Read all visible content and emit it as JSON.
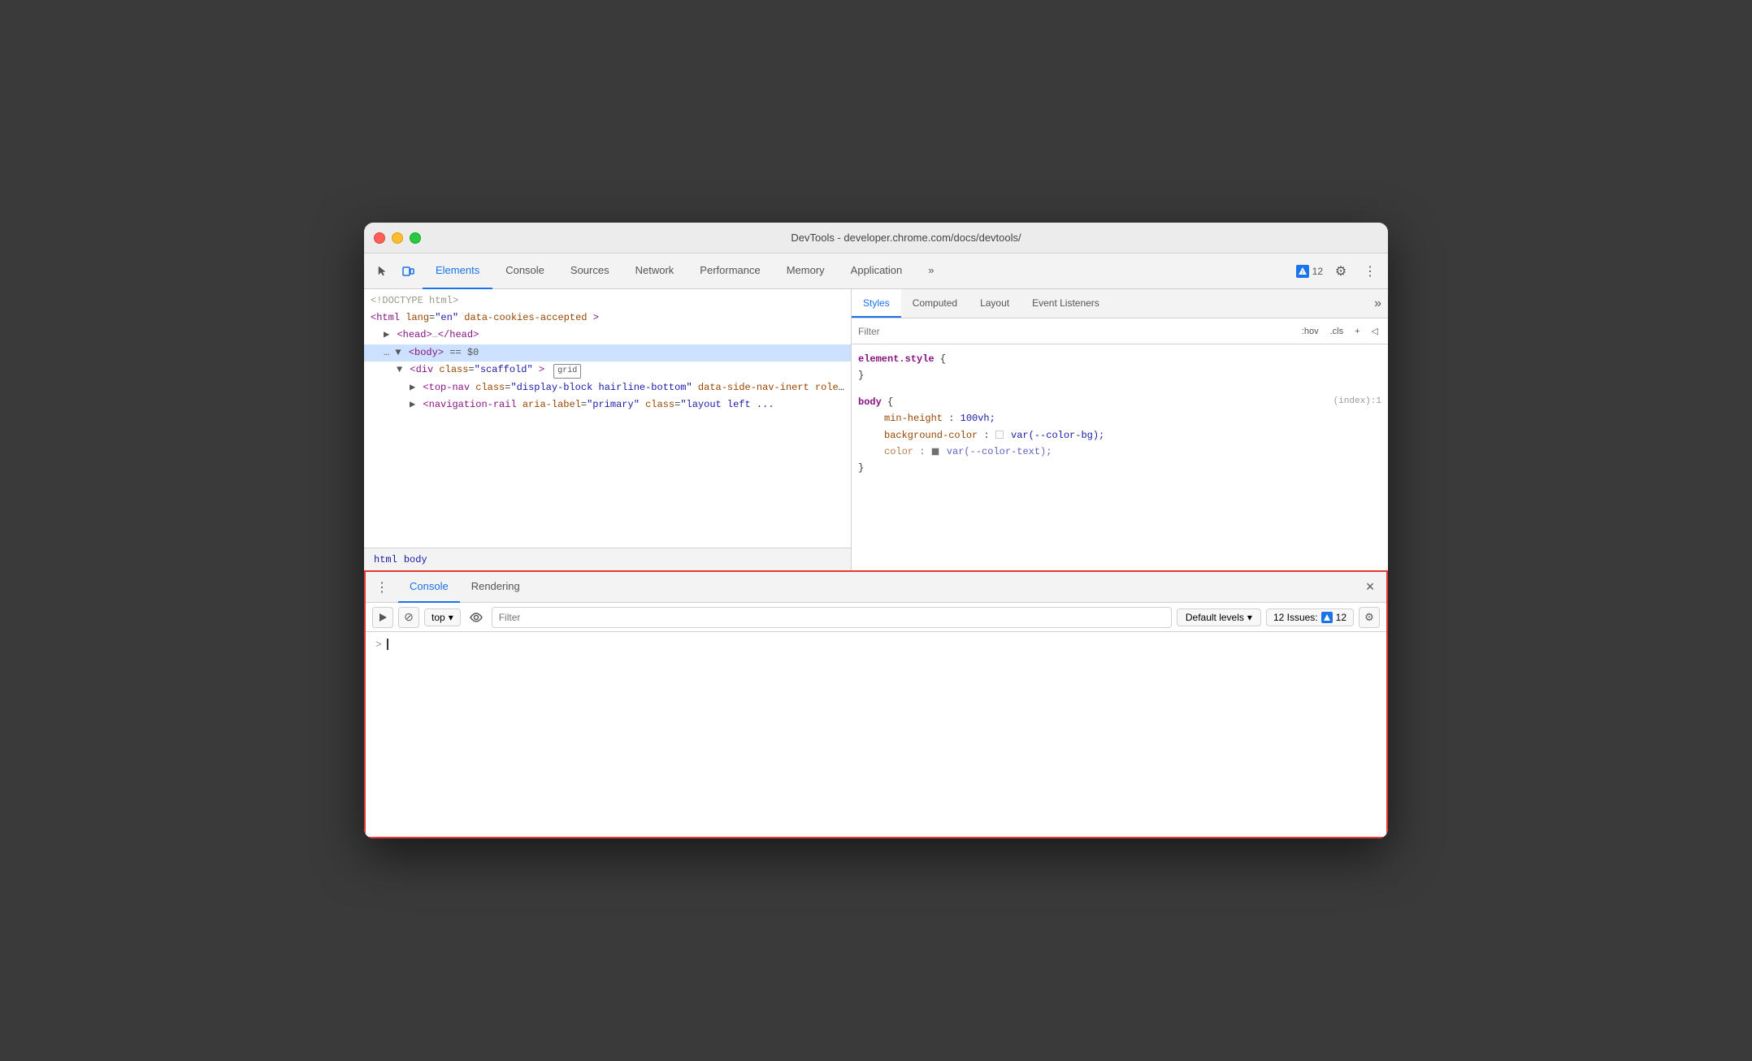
{
  "window": {
    "title": "DevTools - developer.chrome.com/docs/devtools/"
  },
  "traffic_lights": {
    "red_label": "close",
    "yellow_label": "minimize",
    "green_label": "maximize"
  },
  "top_toolbar": {
    "cursor_icon": "⬚",
    "device_icon": "▭",
    "tabs": [
      {
        "id": "elements",
        "label": "Elements",
        "active": true
      },
      {
        "id": "console",
        "label": "Console",
        "active": false
      },
      {
        "id": "sources",
        "label": "Sources",
        "active": false
      },
      {
        "id": "network",
        "label": "Network",
        "active": false
      },
      {
        "id": "performance",
        "label": "Performance",
        "active": false
      },
      {
        "id": "memory",
        "label": "Memory",
        "active": false
      },
      {
        "id": "application",
        "label": "Application",
        "active": false
      }
    ],
    "more_tabs": "»",
    "issues_count": "12",
    "settings_icon": "⚙",
    "more_icon": "⋮"
  },
  "elements_panel": {
    "html_lines": [
      {
        "indent": 0,
        "content": "<!DOCTYPE html>",
        "type": "comment"
      },
      {
        "indent": 0,
        "content": "<html lang=\"en\" data-cookies-accepted>",
        "type": "html"
      },
      {
        "indent": 1,
        "content": "▶ <head>…</head>",
        "type": "html"
      },
      {
        "indent": 1,
        "content": "▼ <body> == $0",
        "type": "html",
        "selected": true
      },
      {
        "indent": 2,
        "content": "▼ <div class=\"scaffold\"> grid",
        "type": "html"
      },
      {
        "indent": 3,
        "content": "▶ <top-nav class=\"display-block hairline-bottom\" data-side-nav-inert role=\"banner\">…</top-nav>",
        "type": "html"
      },
      {
        "indent": 3,
        "content": "▶ <navigation-rail aria-label=\"primary\" class=\"layout left ...",
        "type": "html"
      }
    ],
    "breadcrumb": [
      "html",
      "body"
    ]
  },
  "styles_panel": {
    "tabs": [
      {
        "id": "styles",
        "label": "Styles",
        "active": true
      },
      {
        "id": "computed",
        "label": "Computed",
        "active": false
      },
      {
        "id": "layout",
        "label": "Layout",
        "active": false
      },
      {
        "id": "event_listeners",
        "label": "Event Listeners",
        "active": false
      }
    ],
    "more": "»",
    "filter_placeholder": "Filter",
    "hov_btn": ":hov",
    "cls_btn": ".cls",
    "plus_btn": "+",
    "toggle_icon": "◁",
    "rules": [
      {
        "selector": "element.style {",
        "close": "}",
        "properties": []
      },
      {
        "selector": "body {",
        "source": "(index):1",
        "close": "}",
        "properties": [
          {
            "name": "min-height",
            "value": "100vh;"
          },
          {
            "name": "background-color",
            "value": "var(--color-bg);",
            "has_swatch": true,
            "swatch_color": "#ffffff"
          },
          {
            "name": "color",
            "value": "var(--color-text);",
            "has_swatch": true,
            "swatch_color": "#333333",
            "faded": true
          }
        ]
      }
    ]
  },
  "console_panel": {
    "menu_icon": "⋮",
    "tabs": [
      {
        "id": "console",
        "label": "Console",
        "active": true
      },
      {
        "id": "rendering",
        "label": "Rendering",
        "active": false
      }
    ],
    "close_icon": "×",
    "actions": {
      "execute_icon": "▶",
      "no_entry_icon": "⊘",
      "context": "top",
      "dropdown_icon": "▾",
      "eye_icon": "👁",
      "filter_placeholder": "Filter",
      "default_levels_label": "Default levels",
      "dropdown_arrow": "▾",
      "issues_label": "12 Issues:",
      "issues_icon": "🛈",
      "issues_count": "12",
      "settings_icon": "⚙"
    }
  }
}
